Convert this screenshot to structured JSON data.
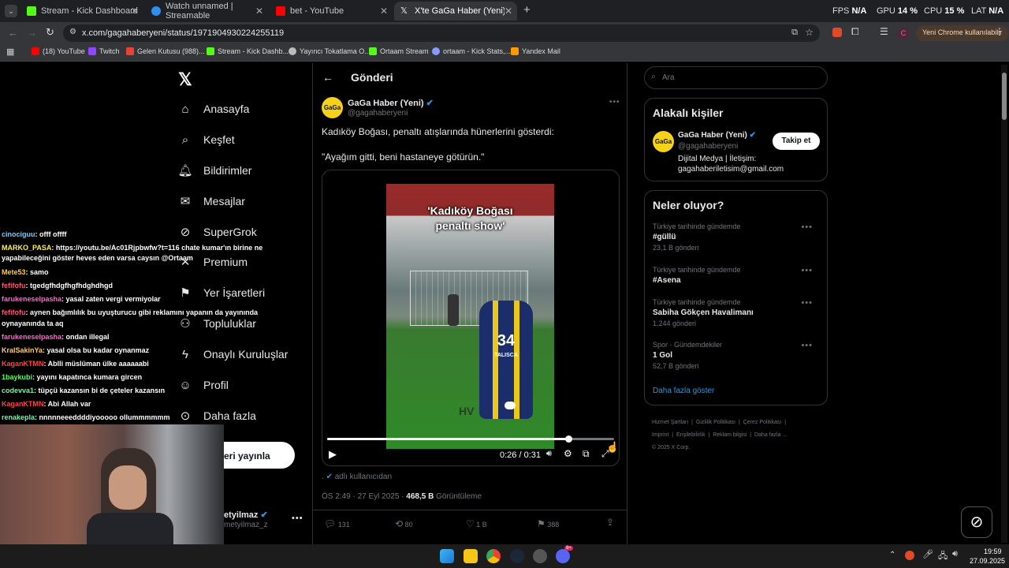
{
  "browser": {
    "tabs": [
      {
        "title": "Stream - Kick Dashboard",
        "color": "#53fc18"
      },
      {
        "title": "Watch unnamed | Streamable",
        "color": "#2f8ff0"
      },
      {
        "title": "bet - YouTube",
        "color": "#ff0000"
      },
      {
        "title": "X'te GaGa Haber (Yeni): \"Kadıköy...",
        "color": "#ffffff"
      }
    ],
    "perf": {
      "fps_label": "FPS",
      "fps_value": "N/A",
      "gpu_label": "GPU",
      "gpu_value": "14 %",
      "cpu_label": "CPU",
      "cpu_value": "15 %",
      "lat_label": "LAT",
      "lat_value": "N/A"
    },
    "url": "x.com/gagahaberyeni/status/1971904930224255119",
    "update_label": "Yeni Chrome kullanılabilir",
    "profile_initial": "C",
    "bookmarks": [
      {
        "label": "(18) YouTube",
        "color": "#ff0000"
      },
      {
        "label": "Twitch",
        "color": "#9146ff"
      },
      {
        "label": "Gelen Kutusu (988)...",
        "color": "#ea4335"
      },
      {
        "label": "Stream - Kick Dashb...",
        "color": "#53fc18"
      },
      {
        "label": "Yayıncı Tokatlama O...",
        "color": "#bbbbbb"
      },
      {
        "label": "Ortaam Stream",
        "color": "#53fc18"
      },
      {
        "label": "ortaam - Kick Stats,...",
        "color": "#8899ff"
      },
      {
        "label": "Yandex Mail",
        "color": "#ff9900"
      }
    ]
  },
  "nav": {
    "items": [
      "Anasayfa",
      "Keşfet",
      "Bildirimler",
      "Mesajlar",
      "SuperGrok",
      "Premium",
      "Yer İşaretleri",
      "Topluluklar",
      "Onaylı Kuruluşlar",
      "Profil",
      "Daha fazla"
    ],
    "post_button": "eri yayınla",
    "account_name": "etyilmaz",
    "account_handle": "metyilmaz_z"
  },
  "post": {
    "header": "Gönderi",
    "author_name": "GaGa Haber (Yeni)",
    "author_handle": "@gagahaberyeni",
    "avatar_text": "GaGa",
    "text_line1": "Kadıköy Boğası, penaltı atışlarında hünerlerini gösterdi:",
    "text_line2": "\"Ayağım gitti, beni hastaneye götürün.\"",
    "video_caption_line1": "'Kadıköy Boğası",
    "video_caption_line2": "penaltı show'",
    "jersey_number": "34",
    "jersey_name": "TALISCA",
    "watermark": "HV",
    "video_time": "0:26 / 0:31",
    "video_progress": 0.84,
    "source_prefix": ".",
    "source_text": "adlı kullanıcıdan",
    "timestamp": "ÖS 2:49 · 27 Eyl 2025 ·",
    "views_count": "468,5 B",
    "views_label": "Görüntüleme",
    "replies": "131",
    "reposts": "80",
    "likes": "1 B",
    "bookmarks": "388"
  },
  "sidebar": {
    "search_placeholder": "Ara",
    "relevant_title": "Alakalı kişiler",
    "person_name": "GaGa Haber (Yeni)",
    "person_handle": "@gagahaberyeni",
    "person_bio_line1": "Dijital Medya | İletişim:",
    "person_bio_line2": "gagahaberiletisim@gmail.com",
    "follow_label": "Takip et",
    "trends_title": "Neler oluyor?",
    "trends": [
      {
        "context": "Türkiye tarihinde gündemde",
        "title": "#güllü",
        "count": "23,1 B gönderi"
      },
      {
        "context": "Türkiye tarihinde gündemde",
        "title": "#Asena",
        "count": ""
      },
      {
        "context": "Türkiye tarihinde gündemde",
        "title": "Sabiha Gökçen Havalimanı",
        "count": "1.244 gönderi"
      },
      {
        "context": "Spor · Gündemdekiler",
        "title": "1 Gol",
        "count": "52,7 B gönderi"
      }
    ],
    "show_more": "Daha fazla göster",
    "footer_line1": [
      "Hizmet Şartları",
      "Gizlilik Politikası",
      "Çerez Politikası"
    ],
    "footer_line2": [
      "Imprint",
      "Erişilebilirlik",
      "Reklam bilgisi",
      "Daha fazla ..."
    ],
    "copyright": "© 2025 X Corp."
  },
  "chat": [
    {
      "user": "cinociguu",
      "color": "#6fd0ff",
      "msg": ": offf offff"
    },
    {
      "user": "MARKO_PASA",
      "color": "#ffee55",
      "msg": ": https://youtu.be/Ac01Rjpbwfw?t=116 chate kumar'ın birine ne"
    },
    {
      "user": "",
      "color": "#ffffff",
      "msg": "yapabileceğini göster heves eden varsa caysın @Ortaam"
    },
    {
      "user": "Mete53",
      "color": "#ffcc33",
      "msg": ": samo"
    },
    {
      "user": "fefifofu",
      "color": "#ff5577",
      "msg": ": tgedgfhdgfhgfhdghdhgd"
    },
    {
      "user": "farukeneselpasha",
      "color": "#ff66cc",
      "msg": ": yasal zaten vergi vermiyolar"
    },
    {
      "user": "fefifofu",
      "color": "#ff5577",
      "msg": ": aynen bağımlılık bu uyuşturucu gibi reklamını yapanın da yayınında"
    },
    {
      "user": "",
      "color": "#ffffff",
      "msg": "oynayanında ta aq"
    },
    {
      "user": "farukeneselpasha",
      "color": "#ff66cc",
      "msg": ": ondan illegal"
    },
    {
      "user": "KralSakinYa",
      "color": "#ffcc66",
      "msg": ": yasal olsa bu kadar oynanmaz"
    },
    {
      "user": "KaganKTMN",
      "color": "#ff4444",
      "msg": ": Ablli müslüman ülke aaaaaabi"
    },
    {
      "user": "1baykubi",
      "color": "#55ff55",
      "msg": ": yayını kapatınca kumara gircen"
    },
    {
      "user": "codevva1",
      "color": "#66ff99",
      "msg": ": tüpçü kazansın bi de çeteler kazansın"
    },
    {
      "user": "KaganKTMN",
      "color": "#ff4444",
      "msg": ": Abi Allah var"
    },
    {
      "user": "renakepla",
      "color": "#66ffaa",
      "msg": ": nnnnneeeddddiyooooo ollummmmmm"
    }
  ],
  "taskbar": {
    "time": "19:59",
    "date": "27.09.2025",
    "badge": "9+"
  }
}
